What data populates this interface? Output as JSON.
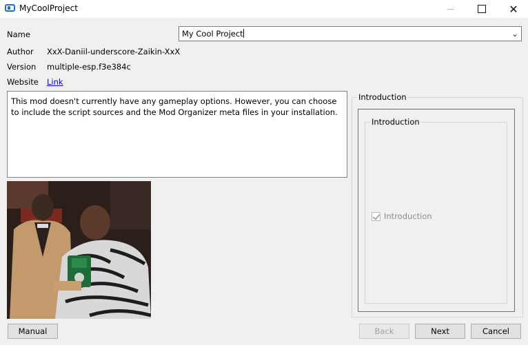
{
  "window": {
    "title": "MyCoolProject",
    "app_icon": "mod-organizer-icon",
    "controls": {
      "minimize": "minimize-icon",
      "maximize": "maximize-icon",
      "close": "✕"
    }
  },
  "form": {
    "name": {
      "label": "Name",
      "value": "My Cool Project"
    },
    "author": {
      "label": "Author",
      "value": "XxX-Daniil-underscore-Zaikin-XxX"
    },
    "version": {
      "label": "Version",
      "value": "multiple-esp.f3e384c"
    },
    "website": {
      "label": "Website",
      "link_text": "Link"
    }
  },
  "description": "This mod doesn't currently have any gameplay options. However, you can choose to include the script sources and the Mod Organizer meta files in your installation.",
  "image": {
    "subject": "photo-two-men-with-watch-box"
  },
  "options_panel": {
    "outer_title": "Introduction",
    "inner_title": "Introduction",
    "option": {
      "label": "Introduction",
      "checked": true,
      "enabled": false
    }
  },
  "buttons": {
    "manual": "Manual",
    "back": "Back",
    "next": "Next",
    "cancel": "Cancel"
  }
}
